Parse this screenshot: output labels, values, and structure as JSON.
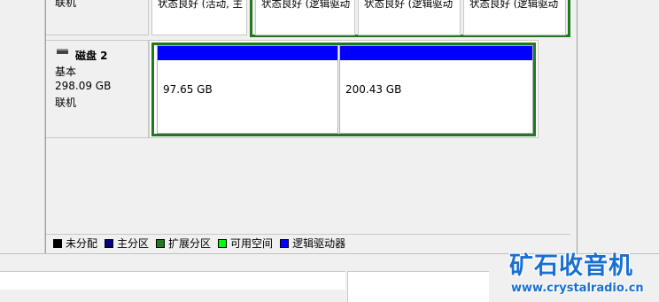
{
  "disk1": {
    "status": "联机",
    "partitions": [
      {
        "text": "状态良好 (活动, 主"
      },
      {
        "text": "状态良好 (逻辑驱动"
      },
      {
        "text": "状态良好 (逻辑驱动"
      },
      {
        "text": "状态良好 (逻辑驱动"
      }
    ]
  },
  "disk2": {
    "name": "磁盘 2",
    "type": "基本",
    "size": "298.09 GB",
    "status": "联机",
    "volumes": [
      {
        "size": "97.65 GB"
      },
      {
        "size": "200.43 GB"
      }
    ]
  },
  "legend": [
    {
      "label": "未分配",
      "color": "#000000"
    },
    {
      "label": "主分区",
      "color": "#000080"
    },
    {
      "label": "扩展分区",
      "color": "#1f7a1f"
    },
    {
      "label": "可用空间",
      "color": "#00ff00"
    },
    {
      "label": "逻辑驱动器",
      "color": "#0000ff"
    }
  ],
  "watermark": {
    "logo": "矿石收音机",
    "url": "www.crystalradio.cn"
  },
  "colors": {
    "logical_bar": "#0000ff",
    "extended_border": "#1f7a1f"
  }
}
